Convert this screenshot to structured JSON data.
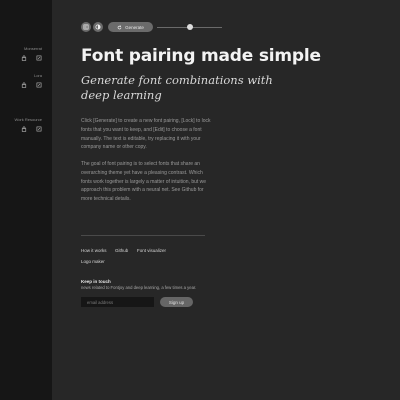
{
  "colors": {
    "sidebar_bg": "#161616",
    "main_bg": "#272727",
    "button_bg": "#6b6b6b",
    "text_primary": "#f3f3f3",
    "text_muted": "#9a9a9a"
  },
  "sidebar": {
    "groups": [
      {
        "label": "Monserrat",
        "icons": [
          "lock-icon",
          "edit-icon"
        ]
      },
      {
        "label": "Lora",
        "icons": [
          "lock-icon",
          "edit-icon"
        ]
      },
      {
        "label": "Work Resource",
        "icons": [
          "lock-icon",
          "edit-icon"
        ]
      }
    ]
  },
  "toolbar": {
    "generate_label": "Generate",
    "slider_value": 0.5,
    "icons": [
      "layout-icon",
      "contrast-icon",
      "refresh-icon"
    ]
  },
  "content": {
    "title": "Font pairing made simple",
    "subtitle": "Generate font combinations with deep learning",
    "paragraph1": "Click [Generate] to create a new font pairing, [Lock] to lock fonts that you want to keep, and [Edit] to choose a font manually. The text is editable, try replacing it with your company name or other copy.",
    "paragraph2": "The goal of font pairing is to select fonts that share an overarching theme yet have a pleasing contrast. Which fonts work together is largely a matter of intuition, but we approach this problem with a neural net. See Github for more technical details."
  },
  "footer": {
    "links": {
      "how_it_works": "How it works",
      "github": "Github",
      "font_visualizer": "Font visualizer",
      "logo_maker": "Logo maker"
    },
    "newsletter": {
      "heading": "Keep in touch",
      "description": "news related to Fontjoy and deep learning, a few times a year.",
      "email_placeholder": "email address",
      "signup_label": "Sign up"
    }
  }
}
